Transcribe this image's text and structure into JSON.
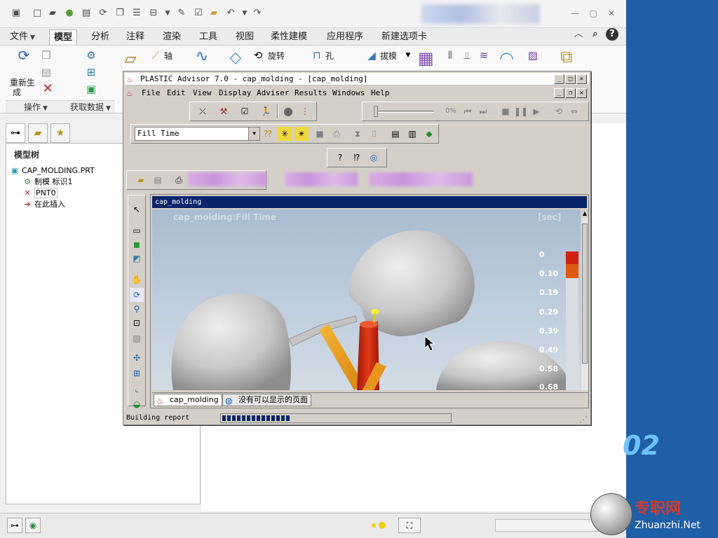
{
  "host": {
    "ribbon_tabs": [
      {
        "label": "文件",
        "has_caret": true
      },
      {
        "label": "模型",
        "active": true
      },
      {
        "label": "分析"
      },
      {
        "label": "注释"
      },
      {
        "label": "渲染"
      },
      {
        "label": "工具"
      },
      {
        "label": "视图"
      },
      {
        "label": "柔性建模"
      },
      {
        "label": "应用程序"
      },
      {
        "label": "新建选项卡"
      }
    ],
    "ribbon": {
      "regenerate_label_1": "重新生",
      "regenerate_label_2": "成",
      "axis_label": "轴",
      "revolve_label": "旋转",
      "hole_label": "孔",
      "draft_label": "拔模",
      "group_operations": "操作",
      "group_get_data": "获取数据"
    },
    "model_tree": {
      "title": "模型树",
      "items": [
        {
          "label": "CAP_MOLDING.PRT"
        },
        {
          "label": "制模 标识1"
        },
        {
          "label": "PNT0"
        },
        {
          "label": "在此插入"
        }
      ]
    }
  },
  "plastic_advisor": {
    "title": "PLASTIC Advisor 7.0 - cap_molding - [cap_molding]",
    "menu": [
      "File",
      "Edit",
      "View",
      "Display",
      "Adviser",
      "Results",
      "Windows",
      "Help"
    ],
    "menu_underline": [
      "F",
      "E",
      "V",
      "D",
      "A",
      "R",
      "W",
      "H"
    ],
    "animation_percent": "0%",
    "result_type": "Fill Time",
    "document_title": "cap_molding",
    "viewport_title": "cap_molding:Fill Time",
    "unit_label": "[sec]",
    "scale_values": [
      "0",
      "0.10",
      "0.19",
      "0.29",
      "0.39",
      "0.49",
      "0.58",
      "0.68"
    ],
    "doc_tabs": [
      {
        "label": "cap_molding",
        "active": true
      },
      {
        "label": "没有可以显示的页面"
      }
    ],
    "status_text": "Building report",
    "progress_fraction": 0.32
  },
  "watermark": {
    "digits": "02",
    "site_cn": "专职网",
    "site_en": "Zhuanzhi.Net"
  },
  "colors": {
    "pa_face": "#d4d0c8",
    "doc_title_bar": "#0a246a",
    "part_color": "#d8d8d8",
    "runner_orange": "#f0a020",
    "sprue_red": "#d02010"
  }
}
